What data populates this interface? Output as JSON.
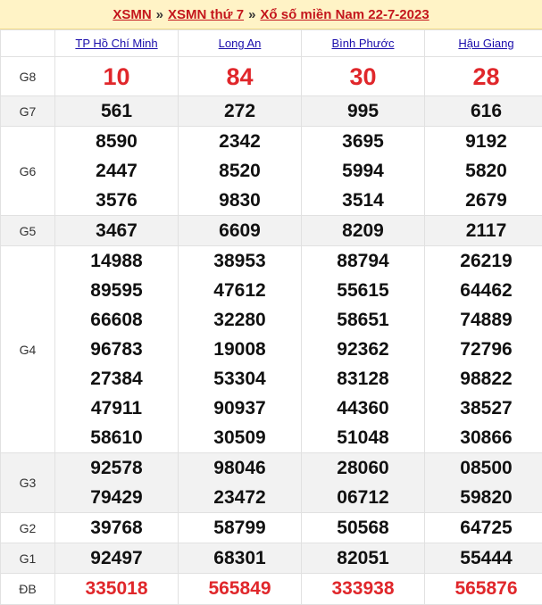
{
  "breadcrumb": {
    "home": "XSMN",
    "sep": "»",
    "day": "XSMN thứ 7",
    "current": "Xổ số miền Nam 22-7-2023"
  },
  "provinces": [
    "TP Hồ Chí Minh",
    "Long An",
    "Bình Phước",
    "Hậu Giang"
  ],
  "prizes": [
    {
      "label": "G8",
      "values": [
        [
          "10"
        ],
        [
          "84"
        ],
        [
          "30"
        ],
        [
          "28"
        ]
      ]
    },
    {
      "label": "G7",
      "values": [
        [
          "561"
        ],
        [
          "272"
        ],
        [
          "995"
        ],
        [
          "616"
        ]
      ]
    },
    {
      "label": "G6",
      "values": [
        [
          "8590",
          "2447",
          "3576"
        ],
        [
          "2342",
          "8520",
          "9830"
        ],
        [
          "3695",
          "5994",
          "3514"
        ],
        [
          "9192",
          "5820",
          "2679"
        ]
      ]
    },
    {
      "label": "G5",
      "values": [
        [
          "3467"
        ],
        [
          "6609"
        ],
        [
          "8209"
        ],
        [
          "2117"
        ]
      ]
    },
    {
      "label": "G4",
      "values": [
        [
          "14988",
          "89595",
          "66608",
          "96783",
          "27384",
          "47911",
          "58610"
        ],
        [
          "38953",
          "47612",
          "32280",
          "19008",
          "53304",
          "90937",
          "30509"
        ],
        [
          "88794",
          "55615",
          "58651",
          "92362",
          "83128",
          "44360",
          "51048"
        ],
        [
          "26219",
          "64462",
          "74889",
          "72796",
          "98822",
          "38527",
          "30866"
        ]
      ]
    },
    {
      "label": "G3",
      "values": [
        [
          "92578",
          "79429"
        ],
        [
          "98046",
          "23472"
        ],
        [
          "28060",
          "06712"
        ],
        [
          "08500",
          "59820"
        ]
      ]
    },
    {
      "label": "G2",
      "values": [
        [
          "39768"
        ],
        [
          "58799"
        ],
        [
          "50568"
        ],
        [
          "64725"
        ]
      ]
    },
    {
      "label": "G1",
      "values": [
        [
          "92497"
        ],
        [
          "68301"
        ],
        [
          "82051"
        ],
        [
          "55444"
        ]
      ]
    },
    {
      "label": "ĐB",
      "values": [
        [
          "335018"
        ],
        [
          "565849"
        ],
        [
          "333938"
        ],
        [
          "565876"
        ]
      ]
    }
  ]
}
